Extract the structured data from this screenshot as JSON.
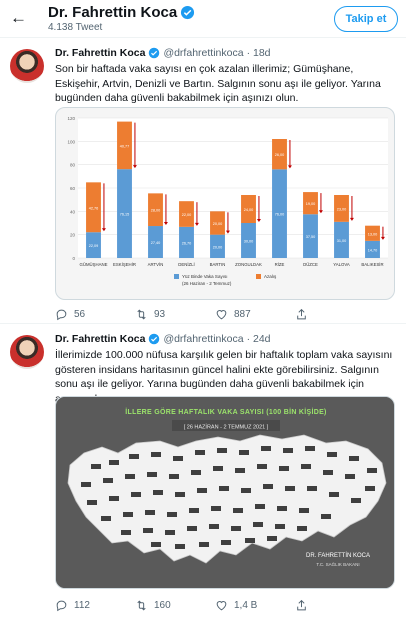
{
  "header": {
    "back_icon": "arrow-left-icon",
    "name": "Dr. Fahrettin Koca",
    "tweet_count": "4.138 Tweet",
    "follow_label": "Takip et",
    "colors": {
      "accent": "#1d9bf0",
      "verified": "#1d9bf0"
    }
  },
  "tweets": [
    {
      "name": "Dr. Fahrettin Koca",
      "handle": "@drfahrettinkoca",
      "time": "· 18d",
      "text": "Son bir haftada vaka sayısı en çok azalan illerimiz; Gümüşhane, Eskişehir, Artvin, Denizli ve Bartın. Salgının sonu aşı ile geliyor. Yarına bugünden daha güvenli bakabilmek için aşınızı olun.",
      "replies": "56",
      "retweets": "93",
      "likes": "887"
    },
    {
      "name": "Dr. Fahrettin Koca",
      "handle": "@drfahrettinkoca",
      "time": "· 24d",
      "text": "İllerimizde 100.000 nüfusa karşılık gelen bir haftalık toplam vaka sayısını gösteren insidans haritasının güncel halini ekte görebilirsiniz. Salgının sonu aşı ile geliyor. Yarına bugünden daha güvenli bakabilmek için aşınızı olun.",
      "replies": "112",
      "retweets": "160",
      "likes": "1,4 B"
    }
  ],
  "map": {
    "title": "İLLERE GÖRE HAFTALIK VAKA SAYISI (100 BİN KİŞİDE)",
    "subtitle": "[ 26 HAZİRAN - 2 TEMMUZ 2021 ]",
    "signature_name": "DR. FAHRETTİN KOCA",
    "signature_role": "T.C. SAĞLIK BAKANI"
  },
  "chart_data": {
    "type": "bar",
    "ylim": [
      0,
      120
    ],
    "categories": [
      "GÜMÜŞHANE",
      "ESKİŞEHİR",
      "ARTVİN",
      "DENİZLİ",
      "BARTIN",
      "ZONGULDAK",
      "RİZE",
      "DÜZCE",
      "YALOVA",
      "BALIKESİR"
    ],
    "series": [
      {
        "name": "Yüz Binde Vaka Sayısı",
        "color": "#5b9bd5",
        "values": [
          22.09,
          76.15,
          27.4,
          26.7,
          20.0,
          30.0,
          76.0,
          37.5,
          31.0,
          14.7
        ]
      },
      {
        "name": "Azalış",
        "color": "#ed7d31",
        "values": [
          42.76,
          40.77,
          28.0,
          22.0,
          20.0,
          24.0,
          26.0,
          19.0,
          23.0,
          13.0
        ]
      }
    ],
    "legend_note": "(26 Haziran - 2 Temmuz)",
    "colors": {
      "arrow": "#c00000"
    }
  }
}
